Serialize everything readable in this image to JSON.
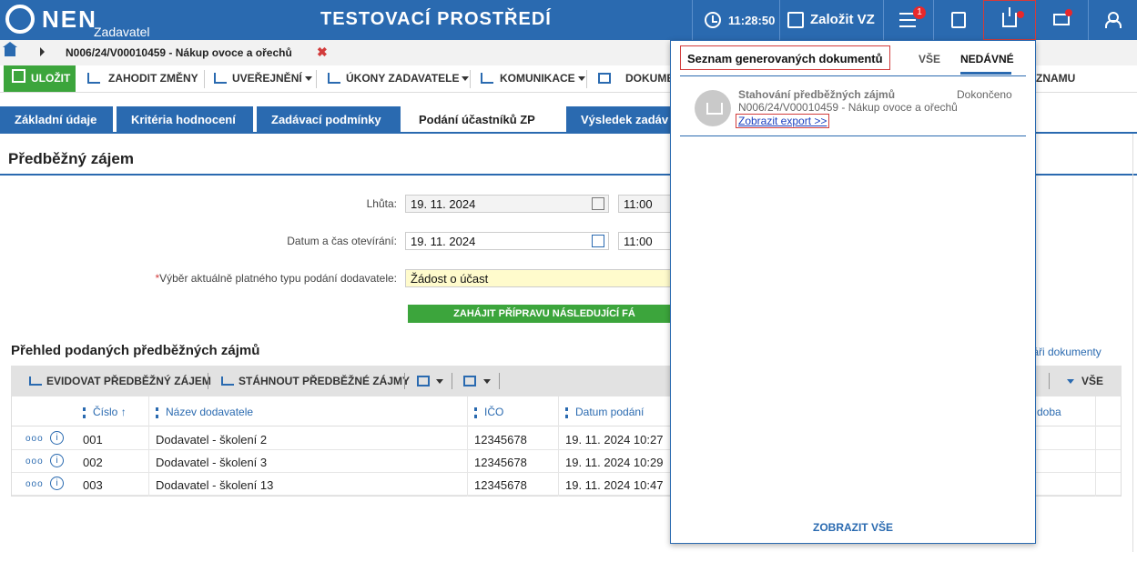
{
  "topbar": {
    "logo_text": "NEN",
    "logo_sub": "Zadavatel",
    "env_title": "TESTOVACÍ PROSTŘEDÍ",
    "clock": "11:28:50",
    "create_label": "Založit VZ",
    "notification_count": "1"
  },
  "breadcrumb": {
    "title": "N006/24/V00010459 - Nákup ovoce a ořechů",
    "close": "✖"
  },
  "toolbar": {
    "save": "ULOŽIT",
    "discard": "ZAHODIT ZMĚNY",
    "publish": "UVEŘEJNĚNÍ",
    "actions": "ÚKONY ZADAVATELE",
    "communication": "KOMUNIKACE",
    "documents": "DOKUME",
    "record_tail": "ZNAMU"
  },
  "tabs": [
    {
      "label": "Základní údaje"
    },
    {
      "label": "Kritéria hodnocení"
    },
    {
      "label": "Zadávací podmínky"
    },
    {
      "label": "Podání účastníků ZP"
    },
    {
      "label": "Výsledek zadáv"
    }
  ],
  "section": {
    "title": "Předběžný zájem",
    "deadline_label": "Lhůta:",
    "deadline_date": "19. 11. 2024",
    "deadline_time": "11:00",
    "open_label": "Datum a čas otevírání:",
    "open_date": "19. 11. 2024",
    "open_time": "11:00",
    "required_mark": "*",
    "type_label": "Výběr aktuálně platného typu podání dodavatele:",
    "type_value": "Žádost o účast",
    "next_phase": "ZAHÁJIT PŘÍPRAVU NÁSLEDUJÍCÍ FÁ"
  },
  "list": {
    "title": "Přehled podaných předběžných zájmů",
    "link_tail": "uláři dokumenty",
    "toolbar": {
      "register": "EVIDOVAT PŘEDBĚŽNÝ ZÁJEM",
      "download": "STÁHNOUT PŘEDBĚŽNÉ ZÁJMY",
      "filter_all": "VŠE"
    },
    "columns": {
      "number": "Číslo",
      "sort": "↑",
      "name": "Název dodavatele",
      "ico": "IČO",
      "date": "Datum podání",
      "tail": "doba"
    },
    "rows": [
      {
        "more": "ooo",
        "info": "i",
        "number": "001",
        "name": "Dodavatel - školení 2",
        "ico": "12345678",
        "date": "19. 11. 2024 10:27"
      },
      {
        "more": "ooo",
        "info": "i",
        "number": "002",
        "name": "Dodavatel - školení 3",
        "ico": "12345678",
        "date": "19. 11. 2024 10:29"
      },
      {
        "more": "ooo",
        "info": "i",
        "number": "003",
        "name": "Dodavatel - školení 13",
        "ico": "12345678",
        "date": "19. 11. 2024 10:47"
      }
    ]
  },
  "panel": {
    "title": "Seznam generovaných dokumentů",
    "tab_all": "VŠE",
    "tab_recent": "NEDÁVNÉ",
    "item": {
      "title": "Stahování předběžných zájmů",
      "status": "Dokončeno",
      "subtitle": "N006/24/V00010459 - Nákup ovoce a ořechů",
      "link": "Zobrazit export >>"
    },
    "show_all": "ZOBRAZIT VŠE"
  }
}
